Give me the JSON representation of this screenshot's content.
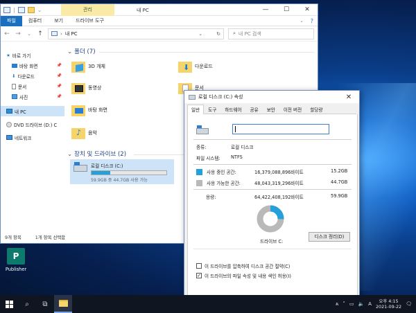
{
  "explorer": {
    "title": "내 PC",
    "context_tab": "관리",
    "ribbon_tabs": [
      "파일",
      "컴퓨터",
      "보기",
      "드라이브 도구"
    ],
    "address": "내 PC",
    "search_placeholder": "내 PC 검색",
    "nav": [
      {
        "label": "바로 가기"
      },
      {
        "label": "바탕 화면"
      },
      {
        "label": "다운로드"
      },
      {
        "label": "문서"
      },
      {
        "label": "사진"
      },
      {
        "label": "내 PC"
      },
      {
        "label": "DVD 드라이브 (D:) C"
      },
      {
        "label": "네트워크"
      }
    ],
    "folders_header": "폴더 (7)",
    "folders": [
      "3D 개체",
      "다운로드",
      "동영상",
      "문서",
      "바탕 화면",
      "음악"
    ],
    "drives_header": "장치 및 드라이브 (2)",
    "drive": {
      "name": "로컬 디스크 (C:)",
      "space": "59.9GB 중 44.7GB 사용 가능",
      "used_fraction": 0.25
    },
    "status": {
      "items": "9개 항목",
      "selected": "1개 항목 선택함"
    }
  },
  "dialog": {
    "title": "로컬 디스크 (C:) 속성",
    "tabs": [
      "일반",
      "도구",
      "하드웨어",
      "공유",
      "보안",
      "이전 버전",
      "할당량"
    ],
    "type_label": "종류:",
    "type_value": "로컬 디스크",
    "fs_label": "파일 시스템:",
    "fs_value": "NTFS",
    "used_label": "사용 중인 공간:",
    "used_bytes": "16,379,088,896바이트",
    "used_gb": "15.2GB",
    "free_label": "사용 가능한 공간:",
    "free_bytes": "48,043,319,296바이트",
    "free_gb": "44.7GB",
    "cap_label": "용량:",
    "cap_bytes": "64,422,408,192바이트",
    "cap_gb": "59.9GB",
    "drive_label": "드라이브 C:",
    "cleanup": "디스크 정리(D)",
    "compress": "이 드라이브를 압축하여 디스크 공간 절약(C)",
    "index": "이 드라이브의 파일 속성 및 내용 색인 허용(I)",
    "used_color": "#26a0da",
    "free_color": "#b9b9b9",
    "used_fraction": 0.254
  },
  "desktop": {
    "publisher": "Publisher"
  },
  "taskbar": {
    "time": "오후 4:15",
    "date": "2021-09-22",
    "lang": "A"
  }
}
